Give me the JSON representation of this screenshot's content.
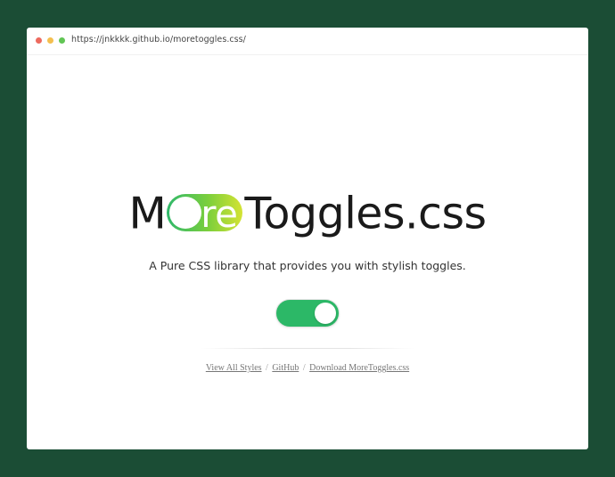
{
  "browser": {
    "url": "https://jnkkkk.github.io/moretoggles.css/"
  },
  "logo": {
    "prefix": "M",
    "highlight": "re",
    "suffix": "Toggles.css"
  },
  "tagline": "A Pure CSS library that provides you with stylish toggles.",
  "demo_toggle": {
    "state": "on",
    "color": "#2cb867"
  },
  "links": {
    "view_all": "View All Styles",
    "separator": "/",
    "github": "GitHub",
    "download": "Download MoreToggles.css"
  },
  "colors": {
    "page_background": "#1b4d35",
    "toggle_on": "#2cb867",
    "logo_gradient_start": "#2fb86b",
    "logo_gradient_end": "#d4e333"
  }
}
